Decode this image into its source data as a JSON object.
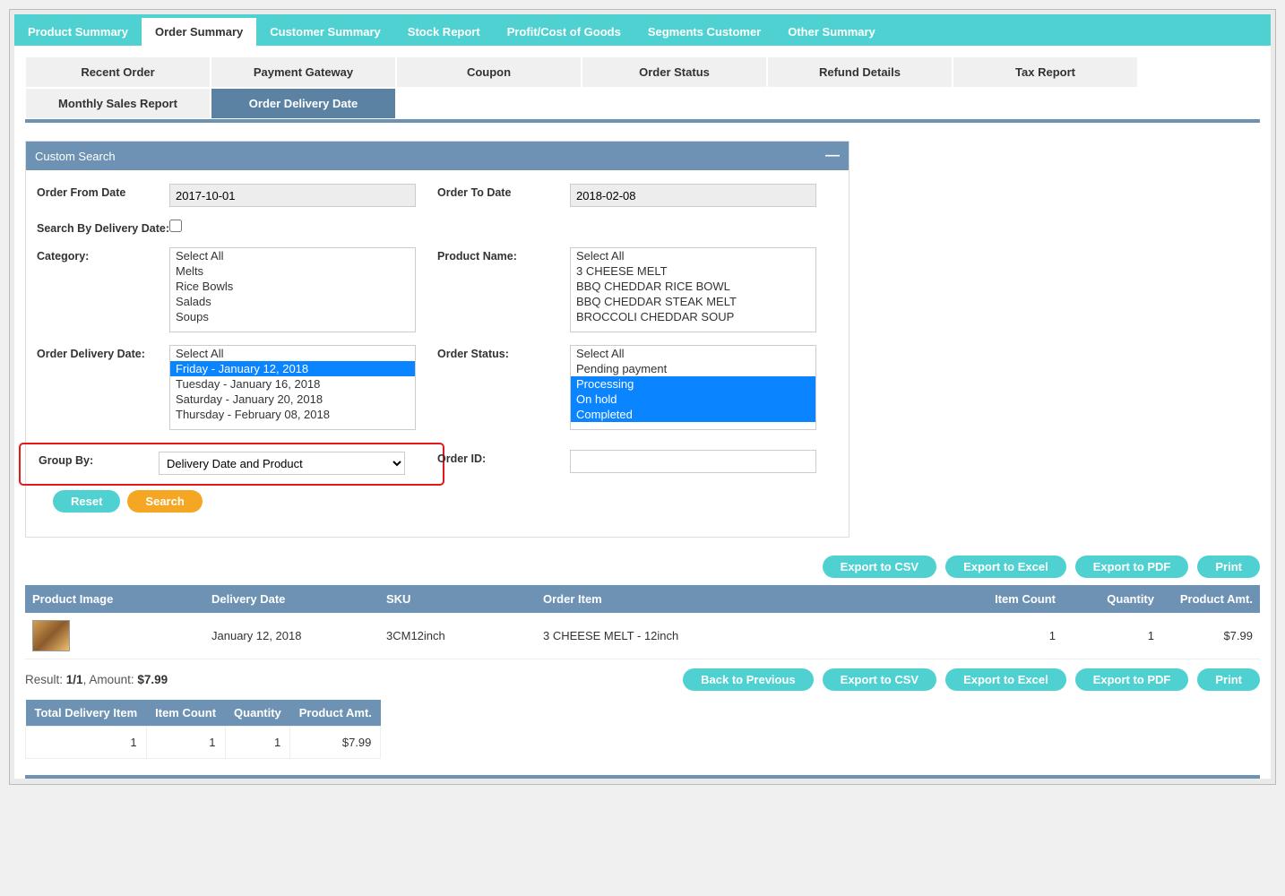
{
  "top_tabs": {
    "product_summary": "Product Summary",
    "order_summary": "Order Summary",
    "customer_summary": "Customer Summary",
    "stock_report": "Stock Report",
    "profit_cost": "Profit/Cost of Goods",
    "segments": "Segments Customer",
    "other": "Other Summary"
  },
  "sub_tabs": {
    "recent_order": "Recent Order",
    "payment_gateway": "Payment Gateway",
    "coupon": "Coupon",
    "order_status": "Order Status",
    "refund_details": "Refund Details",
    "tax_report": "Tax Report",
    "monthly_sales": "Monthly Sales Report",
    "order_delivery_date": "Order Delivery Date"
  },
  "search": {
    "panel_title": "Custom Search",
    "labels": {
      "from_date": "Order From Date",
      "to_date": "Order To Date",
      "by_delivery": "Search By Delivery Date:",
      "category": "Category:",
      "product_name": "Product Name:",
      "delivery_date": "Order Delivery Date:",
      "order_status": "Order Status:",
      "group_by": "Group By:",
      "order_id": "Order ID:"
    },
    "values": {
      "from_date": "2017-10-01",
      "to_date": "2018-02-08",
      "group_by": "Delivery Date and Product",
      "order_id": ""
    },
    "category_options": [
      "Select All",
      "Melts",
      "Rice Bowls",
      "Salads",
      "Soups"
    ],
    "product_options": [
      "Select All",
      "3 CHEESE MELT",
      "BBQ CHEDDAR RICE BOWL",
      "BBQ CHEDDAR STEAK MELT",
      "BROCCOLI CHEDDAR SOUP"
    ],
    "delivery_date_options": [
      "Select All",
      "Friday - January 12, 2018",
      "Tuesday - January 16, 2018",
      "Saturday - January 20, 2018",
      "Thursday - February 08, 2018"
    ],
    "delivery_date_selected": [
      1
    ],
    "status_options": [
      "Select All",
      "Pending payment",
      "Processing",
      "On hold",
      "Completed"
    ],
    "status_selected": [
      2,
      3,
      4
    ]
  },
  "buttons": {
    "reset": "Reset",
    "search": "Search",
    "export_csv": "Export to CSV",
    "export_excel": "Export to Excel",
    "export_pdf": "Export to PDF",
    "print": "Print",
    "back": "Back to Previous"
  },
  "table": {
    "headers": {
      "image": "Product Image",
      "delivery_date": "Delivery Date",
      "sku": "SKU",
      "order_item": "Order Item",
      "item_count": "Item Count",
      "quantity": "Quantity",
      "amount": "Product Amt."
    },
    "rows": [
      {
        "delivery_date": "January 12, 2018",
        "sku": "3CM12inch",
        "order_item": "3 CHEESE MELT - 12inch",
        "item_count": "1",
        "quantity": "1",
        "amount": "$7.99"
      }
    ]
  },
  "result_summary": {
    "prefix": "Result: ",
    "count": "1/1",
    "amount_label": ", Amount: ",
    "amount": "$7.99"
  },
  "totals": {
    "headers": {
      "delivery_item": "Total Delivery Item",
      "item_count": "Item Count",
      "quantity": "Quantity",
      "amount": "Product Amt."
    },
    "values": {
      "delivery_item": "1",
      "item_count": "1",
      "quantity": "1",
      "amount": "$7.99"
    }
  }
}
